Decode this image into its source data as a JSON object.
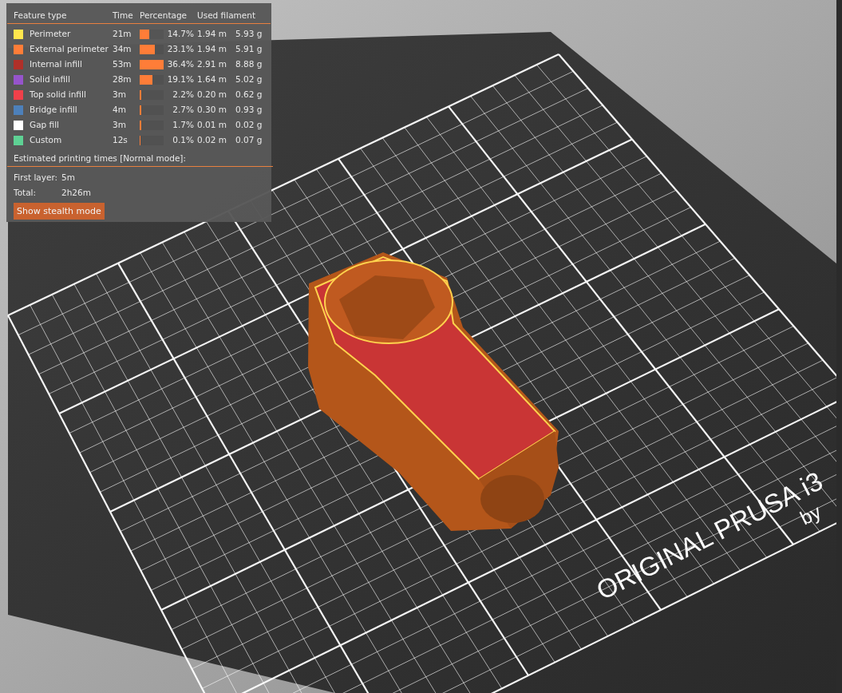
{
  "legend": {
    "columns": [
      "Feature type",
      "Time",
      "Percentage",
      "Used filament"
    ],
    "features": [
      {
        "name": "Perimeter",
        "color": "#ffe64d",
        "time": "21m",
        "level": 0.4,
        "percentage": "14.7%",
        "length": "1.94 m",
        "weight": "5.93 g"
      },
      {
        "name": "External perimeter",
        "color": "#ff7d38",
        "time": "34m",
        "level": 0.63,
        "percentage": "23.1%",
        "length": "1.94 m",
        "weight": "5.91 g"
      },
      {
        "name": "Internal infill",
        "color": "#b03029",
        "time": "53m",
        "level": 1.0,
        "percentage": "36.4%",
        "length": "2.91 m",
        "weight": "8.88 g"
      },
      {
        "name": "Solid infill",
        "color": "#9654cc",
        "time": "28m",
        "level": 0.52,
        "percentage": "19.1%",
        "length": "1.64 m",
        "weight": "5.02 g"
      },
      {
        "name": "Top solid infill",
        "color": "#f0404a",
        "time": "3m",
        "level": 0.06,
        "percentage": "2.2%",
        "length": "0.20 m",
        "weight": "0.62 g"
      },
      {
        "name": "Bridge infill",
        "color": "#4d80ba",
        "time": "4m",
        "level": 0.07,
        "percentage": "2.7%",
        "length": "0.30 m",
        "weight": "0.93 g"
      },
      {
        "name": "Gap fill",
        "color": "#ffffff",
        "time": "3m",
        "level": 0.05,
        "percentage": "1.7%",
        "length": "0.01 m",
        "weight": "0.02 g"
      },
      {
        "name": "Custom",
        "color": "#5ed194",
        "time": "12s",
        "level": 0.01,
        "percentage": "0.1%",
        "length": "0.02 m",
        "weight": "0.07 g"
      }
    ],
    "estimate": {
      "title": "Estimated printing times [Normal mode]:",
      "rows": [
        {
          "label": "First layer:",
          "value": "5m"
        },
        {
          "label": "Total:",
          "value": "2h26m"
        }
      ],
      "button": "Show stealth mode"
    }
  },
  "bed": {
    "labels": [
      "ORIGINAL PRUSA i3",
      "by"
    ]
  }
}
